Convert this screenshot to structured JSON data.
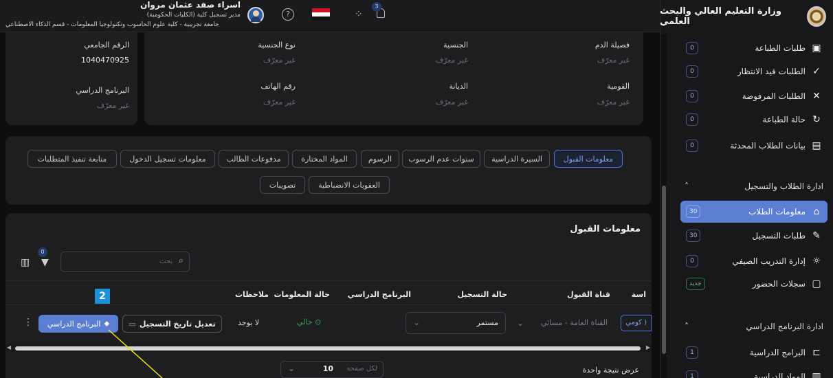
{
  "header": {
    "app_title": "وزارة التعليم العالي والبحث العلمي",
    "user_name": "اسراء صفد عثمان مروان",
    "user_role": "مدير تسجيل كلية (الكليات الحكومية)",
    "user_org": "جامعة تجريبية - كلية علوم الحاسوب وتكنولوجيا المعلومات - قسم الذكاء الاصطناعي",
    "notif_count": "3",
    "help": "?"
  },
  "sidebar": {
    "items": [
      {
        "label": "طلبات الطباعة",
        "badge": "0",
        "icon": "id-card-icon"
      },
      {
        "label": "الطلبات قيد الانتظار",
        "badge": "0",
        "icon": "check-icon"
      },
      {
        "label": "الطلبات المرفوضة",
        "badge": "0",
        "icon": "x-icon"
      },
      {
        "label": "حالة الطباعة",
        "badge": "0",
        "icon": "refresh-icon"
      },
      {
        "label": "بيانات الطلاب المحدثة",
        "badge": "0",
        "icon": "file-icon"
      }
    ],
    "section1": "ادارة الطلاب والتسجيل",
    "items2": [
      {
        "label": "معلومات الطلاب",
        "badge": "30",
        "icon": "graduate-icon"
      },
      {
        "label": "طلبات التسجيل",
        "badge": "30",
        "icon": "edit-icon"
      },
      {
        "label": "إدارة التدريب الصيفي",
        "badge": "0",
        "icon": "sun-icon"
      },
      {
        "label": "سجلات الحضور",
        "badge": "جديد",
        "icon": "clipboard-icon"
      }
    ],
    "section2": "ادارة البرنامج الدراسي",
    "items3": [
      {
        "label": "البرامج الدراسية",
        "badge": "1",
        "icon": "programs-icon"
      },
      {
        "label": "المواد الدراسية",
        "badge": "1",
        "icon": "book-icon"
      }
    ]
  },
  "info": {
    "blood_label": "فصيلة الدم",
    "blood_value": "غير معرّف",
    "nationality_label": "الجنسية",
    "nationality_value": "غير معرّف",
    "nat_type_label": "نوع الجنسية",
    "nat_type_value": "غير معرّف",
    "national_label": "القومية",
    "national_value": "غير معرّف",
    "religion_label": "الديانة",
    "religion_value": "غير معرّف",
    "phone_label": "رقم الهاتف",
    "phone_value": "غير معرّف",
    "uni_no_label": "الرقم الجامعي",
    "uni_no_value": "1040470925",
    "program_label": "البرنامج الدراسي",
    "program_value": "غير معرّف"
  },
  "tabs_row1": [
    "معلومات القبول",
    "السيرة الدراسية",
    "سنوات عدم الرسوب",
    "الرسوم",
    "المواد المختارة",
    "مدفوعات الطالب",
    "معلومات تسجيل الدخول",
    "متابعة تنفيذ المتطلبات"
  ],
  "tabs_row2": [
    "العقوبات الانضباطية",
    "تصويبات"
  ],
  "admission": {
    "title": "معلومات القبول",
    "search_placeholder": "بحث",
    "filter_count": "0",
    "columns": [
      "اسة",
      "قناة القبول",
      "حالة التسجيل",
      "البرنامج الدراسي",
      "حالة المعلومات",
      "ملاحظات"
    ],
    "row": {
      "study_badge": "كومي )",
      "channel": "القناة العامة - مسائي",
      "status": "مستمر",
      "info_status": "حالي",
      "notes": "لا يوجد",
      "edit_btn": "تعديل تاريخ التسجيل",
      "program_btn": "البرنامج الدراسي",
      "more": "⋮"
    },
    "step": "2",
    "results": "عرض نتيجة واحدة",
    "per_page_label": "لكل صفحة",
    "per_page": "10"
  },
  "colors": {
    "accent": "#5a7ed2",
    "green": "#3aa55c",
    "step": "#1e90d8"
  }
}
